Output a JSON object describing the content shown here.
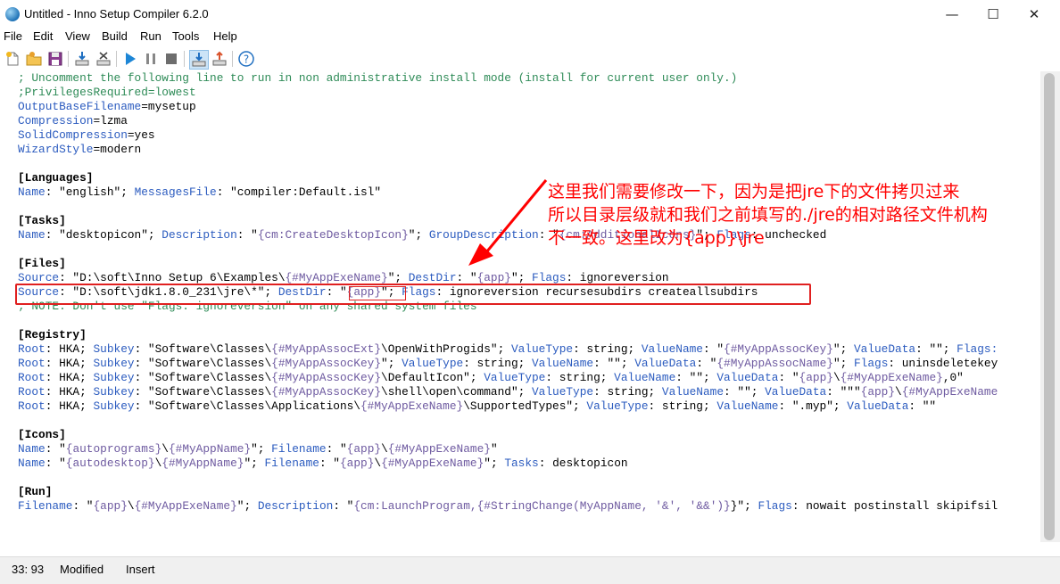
{
  "window": {
    "title": "Untitled - Inno Setup Compiler 6.2.0",
    "min_glyph": "—",
    "max_glyph": "☐",
    "close_glyph": "✕"
  },
  "menu": [
    "File",
    "Edit",
    "View",
    "Build",
    "Run",
    "Tools",
    "Help"
  ],
  "toolbar": {
    "icons": [
      "new-icon",
      "open-icon",
      "save-icon",
      "compile-icon",
      "stop-compile-icon",
      "run-icon",
      "pause-icon",
      "terminate-icon",
      "target-load-icon",
      "target-save-icon",
      "help-icon"
    ]
  },
  "editor": {
    "lines": [
      [
        {
          "t": "; Uncomment the following line to run in non administrative install mode (install for current user only.)",
          "c": "cm"
        }
      ],
      [
        {
          "t": ";PrivilegesRequired=lowest",
          "c": "cm"
        }
      ],
      [
        {
          "t": "OutputBaseFilename",
          "c": "kw"
        },
        {
          "t": "=mysetup",
          "c": ""
        }
      ],
      [
        {
          "t": "Compression",
          "c": "kw"
        },
        {
          "t": "=lzma",
          "c": ""
        }
      ],
      [
        {
          "t": "SolidCompression",
          "c": "kw"
        },
        {
          "t": "=yes",
          "c": ""
        }
      ],
      [
        {
          "t": "WizardStyle",
          "c": "kw"
        },
        {
          "t": "=modern",
          "c": ""
        }
      ],
      [],
      [
        {
          "t": "[Languages]",
          "c": "sec"
        }
      ],
      [
        {
          "t": "Name",
          "c": "kw"
        },
        {
          "t": ": \"english\"; ",
          "c": ""
        },
        {
          "t": "MessagesFile",
          "c": "kw"
        },
        {
          "t": ": \"compiler:Default.isl\"",
          "c": ""
        }
      ],
      [],
      [
        {
          "t": "[Tasks]",
          "c": "sec"
        }
      ],
      [
        {
          "t": "Name",
          "c": "kw"
        },
        {
          "t": ": \"desktopicon\"; ",
          "c": ""
        },
        {
          "t": "Description",
          "c": "kw"
        },
        {
          "t": ": \"",
          "c": ""
        },
        {
          "t": "{cm:CreateDesktopIcon}",
          "c": "const"
        },
        {
          "t": "\"; ",
          "c": ""
        },
        {
          "t": "GroupDescription",
          "c": "kw"
        },
        {
          "t": ": \"",
          "c": ""
        },
        {
          "t": "{cm:AdditionalIcons}",
          "c": "const"
        },
        {
          "t": "\"; ",
          "c": ""
        },
        {
          "t": "Flags",
          "c": "kw"
        },
        {
          "t": ": unchecked",
          "c": ""
        }
      ],
      [],
      [
        {
          "t": "[Files]",
          "c": "sec"
        }
      ],
      [
        {
          "t": "Source",
          "c": "kw"
        },
        {
          "t": ": \"D:\\soft\\Inno Setup 6\\Examples\\",
          "c": ""
        },
        {
          "t": "{#MyAppExeName}",
          "c": "const"
        },
        {
          "t": "\"; ",
          "c": ""
        },
        {
          "t": "DestDir",
          "c": "kw"
        },
        {
          "t": ": \"",
          "c": ""
        },
        {
          "t": "{app}",
          "c": "const"
        },
        {
          "t": "\"; ",
          "c": ""
        },
        {
          "t": "Flags",
          "c": "kw"
        },
        {
          "t": ": ignoreversion",
          "c": ""
        }
      ],
      [
        {
          "t": "Source",
          "c": "kw"
        },
        {
          "t": ": \"D:\\soft\\jdk1.8.0_231\\jre\\*\"; ",
          "c": ""
        },
        {
          "t": "DestDir",
          "c": "kw"
        },
        {
          "t": ": \"",
          "c": ""
        },
        {
          "t": "{app}",
          "c": "const"
        },
        {
          "t": "\"; ",
          "c": ""
        },
        {
          "t": "Flags",
          "c": "kw"
        },
        {
          "t": ": ignoreversion recursesubdirs createallsubdirs",
          "c": ""
        }
      ],
      [
        {
          "t": "; NOTE: Don't use \"Flags: ignoreversion\" on any shared system files",
          "c": "cm"
        }
      ],
      [],
      [
        {
          "t": "[Registry]",
          "c": "sec"
        }
      ],
      [
        {
          "t": "Root",
          "c": "kw"
        },
        {
          "t": ": HKA; ",
          "c": ""
        },
        {
          "t": "Subkey",
          "c": "kw"
        },
        {
          "t": ": \"Software\\Classes\\",
          "c": ""
        },
        {
          "t": "{#MyAppAssocExt}",
          "c": "const"
        },
        {
          "t": "\\OpenWithProgids\"; ",
          "c": ""
        },
        {
          "t": "ValueType",
          "c": "kw"
        },
        {
          "t": ": string; ",
          "c": ""
        },
        {
          "t": "ValueName",
          "c": "kw"
        },
        {
          "t": ": \"",
          "c": ""
        },
        {
          "t": "{#MyAppAssocKey}",
          "c": "const"
        },
        {
          "t": "\"; ",
          "c": ""
        },
        {
          "t": "ValueData",
          "c": "kw"
        },
        {
          "t": ": \"\"; ",
          "c": ""
        },
        {
          "t": "Flags:",
          "c": "kw"
        }
      ],
      [
        {
          "t": "Root",
          "c": "kw"
        },
        {
          "t": ": HKA; ",
          "c": ""
        },
        {
          "t": "Subkey",
          "c": "kw"
        },
        {
          "t": ": \"Software\\Classes\\",
          "c": ""
        },
        {
          "t": "{#MyAppAssocKey}",
          "c": "const"
        },
        {
          "t": "\"; ",
          "c": ""
        },
        {
          "t": "ValueType",
          "c": "kw"
        },
        {
          "t": ": string; ",
          "c": ""
        },
        {
          "t": "ValueName",
          "c": "kw"
        },
        {
          "t": ": \"\"; ",
          "c": ""
        },
        {
          "t": "ValueData",
          "c": "kw"
        },
        {
          "t": ": \"",
          "c": ""
        },
        {
          "t": "{#MyAppAssocName}",
          "c": "const"
        },
        {
          "t": "\"; ",
          "c": ""
        },
        {
          "t": "Flags",
          "c": "kw"
        },
        {
          "t": ": uninsdeletekey",
          "c": ""
        }
      ],
      [
        {
          "t": "Root",
          "c": "kw"
        },
        {
          "t": ": HKA; ",
          "c": ""
        },
        {
          "t": "Subkey",
          "c": "kw"
        },
        {
          "t": ": \"Software\\Classes\\",
          "c": ""
        },
        {
          "t": "{#MyAppAssocKey}",
          "c": "const"
        },
        {
          "t": "\\DefaultIcon\"; ",
          "c": ""
        },
        {
          "t": "ValueType",
          "c": "kw"
        },
        {
          "t": ": string; ",
          "c": ""
        },
        {
          "t": "ValueName",
          "c": "kw"
        },
        {
          "t": ": \"\"; ",
          "c": ""
        },
        {
          "t": "ValueData",
          "c": "kw"
        },
        {
          "t": ": \"",
          "c": ""
        },
        {
          "t": "{app}",
          "c": "const"
        },
        {
          "t": "\\",
          "c": ""
        },
        {
          "t": "{#MyAppExeName}",
          "c": "const"
        },
        {
          "t": ",0\"",
          "c": ""
        }
      ],
      [
        {
          "t": "Root",
          "c": "kw"
        },
        {
          "t": ": HKA; ",
          "c": ""
        },
        {
          "t": "Subkey",
          "c": "kw"
        },
        {
          "t": ": \"Software\\Classes\\",
          "c": ""
        },
        {
          "t": "{#MyAppAssocKey}",
          "c": "const"
        },
        {
          "t": "\\shell\\open\\command\"; ",
          "c": ""
        },
        {
          "t": "ValueType",
          "c": "kw"
        },
        {
          "t": ": string; ",
          "c": ""
        },
        {
          "t": "ValueName",
          "c": "kw"
        },
        {
          "t": ": \"\"; ",
          "c": ""
        },
        {
          "t": "ValueData",
          "c": "kw"
        },
        {
          "t": ": \"\"\"",
          "c": ""
        },
        {
          "t": "{app}",
          "c": "const"
        },
        {
          "t": "\\",
          "c": ""
        },
        {
          "t": "{#MyAppExeName",
          "c": "const"
        }
      ],
      [
        {
          "t": "Root",
          "c": "kw"
        },
        {
          "t": ": HKA; ",
          "c": ""
        },
        {
          "t": "Subkey",
          "c": "kw"
        },
        {
          "t": ": \"Software\\Classes\\Applications\\",
          "c": ""
        },
        {
          "t": "{#MyAppExeName}",
          "c": "const"
        },
        {
          "t": "\\SupportedTypes\"; ",
          "c": ""
        },
        {
          "t": "ValueType",
          "c": "kw"
        },
        {
          "t": ": string; ",
          "c": ""
        },
        {
          "t": "ValueName",
          "c": "kw"
        },
        {
          "t": ": \".myp\"; ",
          "c": ""
        },
        {
          "t": "ValueData",
          "c": "kw"
        },
        {
          "t": ": \"\"",
          "c": ""
        }
      ],
      [],
      [
        {
          "t": "[Icons]",
          "c": "sec"
        }
      ],
      [
        {
          "t": "Name",
          "c": "kw"
        },
        {
          "t": ": \"",
          "c": ""
        },
        {
          "t": "{autoprograms}",
          "c": "const"
        },
        {
          "t": "\\",
          "c": ""
        },
        {
          "t": "{#MyAppName}",
          "c": "const"
        },
        {
          "t": "\"; ",
          "c": ""
        },
        {
          "t": "Filename",
          "c": "kw"
        },
        {
          "t": ": \"",
          "c": ""
        },
        {
          "t": "{app}",
          "c": "const"
        },
        {
          "t": "\\",
          "c": ""
        },
        {
          "t": "{#MyAppExeName}",
          "c": "const"
        },
        {
          "t": "\"",
          "c": ""
        }
      ],
      [
        {
          "t": "Name",
          "c": "kw"
        },
        {
          "t": ": \"",
          "c": ""
        },
        {
          "t": "{autodesktop}",
          "c": "const"
        },
        {
          "t": "\\",
          "c": ""
        },
        {
          "t": "{#MyAppName}",
          "c": "const"
        },
        {
          "t": "\"; ",
          "c": ""
        },
        {
          "t": "Filename",
          "c": "kw"
        },
        {
          "t": ": \"",
          "c": ""
        },
        {
          "t": "{app}",
          "c": "const"
        },
        {
          "t": "\\",
          "c": ""
        },
        {
          "t": "{#MyAppExeName}",
          "c": "const"
        },
        {
          "t": "\"; ",
          "c": ""
        },
        {
          "t": "Tasks",
          "c": "kw"
        },
        {
          "t": ": desktopicon",
          "c": ""
        }
      ],
      [],
      [
        {
          "t": "[Run]",
          "c": "sec"
        }
      ],
      [
        {
          "t": "Filename",
          "c": "kw"
        },
        {
          "t": ": \"",
          "c": ""
        },
        {
          "t": "{app}",
          "c": "const"
        },
        {
          "t": "\\",
          "c": ""
        },
        {
          "t": "{#MyAppExeName}",
          "c": "const"
        },
        {
          "t": "\"; ",
          "c": ""
        },
        {
          "t": "Description",
          "c": "kw"
        },
        {
          "t": ": \"",
          "c": ""
        },
        {
          "t": "{cm:LaunchProgram,",
          "c": "const"
        },
        {
          "t": "{#StringChange(MyAppName, '&', '&&')}",
          "c": "const"
        },
        {
          "t": "}\"; ",
          "c": ""
        },
        {
          "t": "Flags",
          "c": "kw"
        },
        {
          "t": ": nowait postinstall skipifsil",
          "c": ""
        }
      ]
    ]
  },
  "annotation": {
    "lines": [
      "这里我们需要修改一下，因为是把jre下的文件拷贝过来",
      "所以目录层级就和我们之前填写的./jre的相对路径文件机构",
      "不一致。这里改为{app}\\jre"
    ],
    "color": "#ff0000"
  },
  "status": {
    "position": "33: 93",
    "modified": "Modified",
    "mode": "Insert"
  }
}
